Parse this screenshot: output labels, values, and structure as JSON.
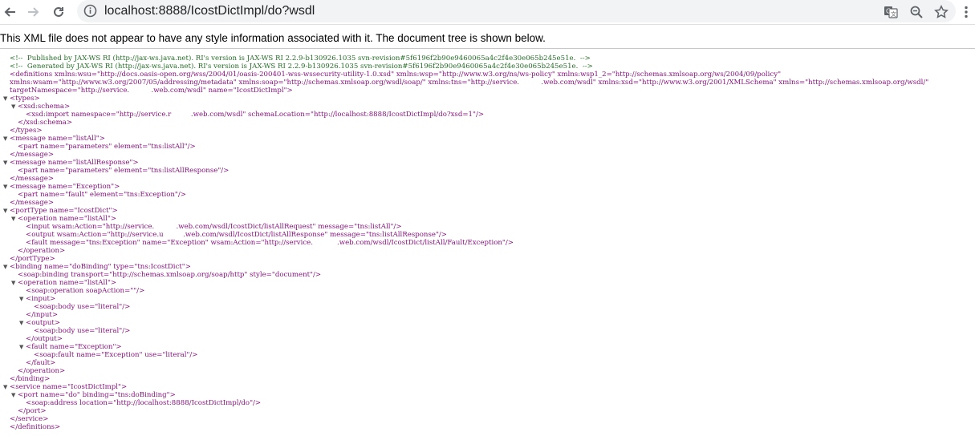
{
  "browser": {
    "url": "localhost:8888/IcostDictImpl/do?wsdl",
    "icons": [
      "back-arrow-icon",
      "forward-arrow-icon",
      "reload-icon",
      "info-icon",
      "translate-icon",
      "zoom-icon",
      "star-icon",
      "menu-dots-icon"
    ]
  },
  "banner": {
    "text": "This XML file does not appear to have any style information associated with it. The document tree is shown below."
  },
  "xml": {
    "lines": [
      {
        "indent": 0,
        "toggle": "",
        "text": "<!--  Published by JAX-WS RI (http://jax-ws.java.net). RI's version is JAX-WS RI 2.2.9-b130926.1035 svn-revision#5f6196f2b90e9460065a4c2f4e30e065b245e51e.  -->",
        "kind": "comment"
      },
      {
        "indent": 0,
        "toggle": "",
        "text": "<!--  Generated by JAX-WS RI (http://jax-ws.java.net). RI's version is JAX-WS RI 2.2.9-b130926.1035 svn-revision#5f6196f2b90e9460065a4c2f4e30e065b245e51e.  -->",
        "kind": "comment"
      },
      {
        "indent": 0,
        "toggle": "",
        "text": "<definitions xmlns:wsu=\"http://docs.oasis-open.org/wss/2004/01/oasis-200401-wss-wssecurity-utility-1.0.xsd\" xmlns:wsp=\"http://www.w3.org/ns/ws-policy\" xmlns:wsp1_2=\"http://schemas.xmlsoap.org/ws/2004/09/policy\"",
        "kind": "tag"
      },
      {
        "indent": 0,
        "toggle": "",
        "text": "xmlns:wsam=\"http://www.w3.org/2007/05/addressing/metadata\" xmlns:soap=\"http://schemas.xmlsoap.org/wsdl/soap/\" xmlns:tns=\"http://service.          .web.com/wsdl\" xmlns:xsd=\"http://www.w3.org/2001/XMLSchema\" xmlns=\"http://schemas.xmlsoap.org/wsdl/\"",
        "kind": "tag"
      },
      {
        "indent": 0,
        "toggle": "",
        "text": "targetNamespace=\"http://service.          .web.com/wsdl\" name=\"IcostDictImpl\">",
        "kind": "tag"
      },
      {
        "indent": 0,
        "toggle": "▼",
        "text": "<types>",
        "kind": "tag"
      },
      {
        "indent": 1,
        "toggle": "▼",
        "text": "<xsd:schema>",
        "kind": "tag"
      },
      {
        "indent": 2,
        "toggle": "",
        "text": "<xsd:import namespace=\"http://service.r         .web.com/wsdl\" schemaLocation=\"http://localhost:8888/IcostDictImpl/do?xsd=1\"/>",
        "kind": "tag"
      },
      {
        "indent": 1,
        "toggle": "",
        "text": "</xsd:schema>",
        "kind": "tag"
      },
      {
        "indent": 0,
        "toggle": "",
        "text": "</types>",
        "kind": "tag"
      },
      {
        "indent": 0,
        "toggle": "▼",
        "text": "<message name=\"listAll\">",
        "kind": "tag"
      },
      {
        "indent": 1,
        "toggle": "",
        "text": "<part name=\"parameters\" element=\"tns:listAll\"/>",
        "kind": "tag"
      },
      {
        "indent": 0,
        "toggle": "",
        "text": "</message>",
        "kind": "tag"
      },
      {
        "indent": 0,
        "toggle": "▼",
        "text": "<message name=\"listAllResponse\">",
        "kind": "tag"
      },
      {
        "indent": 1,
        "toggle": "",
        "text": "<part name=\"parameters\" element=\"tns:listAllResponse\"/>",
        "kind": "tag"
      },
      {
        "indent": 0,
        "toggle": "",
        "text": "</message>",
        "kind": "tag"
      },
      {
        "indent": 0,
        "toggle": "▼",
        "text": "<message name=\"Exception\">",
        "kind": "tag"
      },
      {
        "indent": 1,
        "toggle": "",
        "text": "<part name=\"fault\" element=\"tns:Exception\"/>",
        "kind": "tag"
      },
      {
        "indent": 0,
        "toggle": "",
        "text": "</message>",
        "kind": "tag"
      },
      {
        "indent": 0,
        "toggle": "▼",
        "text": "<portType name=\"IcostDict\">",
        "kind": "tag"
      },
      {
        "indent": 1,
        "toggle": "▼",
        "text": "<operation name=\"listAll\">",
        "kind": "tag"
      },
      {
        "indent": 2,
        "toggle": "",
        "text": "<input wsam:Action=\"http://service.          .web.com/wsdl/IcostDict/listAllRequest\" message=\"tns:listAll\"/>",
        "kind": "tag"
      },
      {
        "indent": 2,
        "toggle": "",
        "text": "<output wsam:Action=\"http://service.u         .web.com/wsdl/IcostDict/listAllResponse\" message=\"tns:listAllResponse\"/>",
        "kind": "tag"
      },
      {
        "indent": 2,
        "toggle": "",
        "text": "<fault message=\"tns:Exception\" name=\"Exception\" wsam:Action=\"http://service.           .web.com/wsdl/IcostDict/listAll/Fault/Exception\"/>",
        "kind": "tag"
      },
      {
        "indent": 1,
        "toggle": "",
        "text": "</operation>",
        "kind": "tag"
      },
      {
        "indent": 0,
        "toggle": "",
        "text": "</portType>",
        "kind": "tag"
      },
      {
        "indent": 0,
        "toggle": "▼",
        "text": "<binding name=\"doBinding\" type=\"tns:IcostDict\">",
        "kind": "tag"
      },
      {
        "indent": 1,
        "toggle": "",
        "text": "<soap:binding transport=\"http://schemas.xmlsoap.org/soap/http\" style=\"document\"/>",
        "kind": "tag"
      },
      {
        "indent": 1,
        "toggle": "▼",
        "text": "<operation name=\"listAll\">",
        "kind": "tag"
      },
      {
        "indent": 2,
        "toggle": "",
        "text": "<soap:operation soapAction=\"\"/>",
        "kind": "tag"
      },
      {
        "indent": 2,
        "toggle": "▼",
        "text": "<input>",
        "kind": "tag"
      },
      {
        "indent": 3,
        "toggle": "",
        "text": "<soap:body use=\"literal\"/>",
        "kind": "tag"
      },
      {
        "indent": 2,
        "toggle": "",
        "text": "</input>",
        "kind": "tag"
      },
      {
        "indent": 2,
        "toggle": "▼",
        "text": "<output>",
        "kind": "tag"
      },
      {
        "indent": 3,
        "toggle": "",
        "text": "<soap:body use=\"literal\"/>",
        "kind": "tag"
      },
      {
        "indent": 2,
        "toggle": "",
        "text": "</output>",
        "kind": "tag"
      },
      {
        "indent": 2,
        "toggle": "▼",
        "text": "<fault name=\"Exception\">",
        "kind": "tag"
      },
      {
        "indent": 3,
        "toggle": "",
        "text": "<soap:fault name=\"Exception\" use=\"literal\"/>",
        "kind": "tag"
      },
      {
        "indent": 2,
        "toggle": "",
        "text": "</fault>",
        "kind": "tag"
      },
      {
        "indent": 1,
        "toggle": "",
        "text": "</operation>",
        "kind": "tag"
      },
      {
        "indent": 0,
        "toggle": "",
        "text": "</binding>",
        "kind": "tag"
      },
      {
        "indent": 0,
        "toggle": "▼",
        "text": "<service name=\"IcostDictImpl\">",
        "kind": "tag"
      },
      {
        "indent": 1,
        "toggle": "▼",
        "text": "<port name=\"do\" binding=\"tns:doBinding\">",
        "kind": "tag"
      },
      {
        "indent": 2,
        "toggle": "",
        "text": "<soap:address location=\"http://localhost:8888/IcostDictImpl/do\"/>",
        "kind": "tag"
      },
      {
        "indent": 1,
        "toggle": "",
        "text": "</port>",
        "kind": "tag"
      },
      {
        "indent": 0,
        "toggle": "",
        "text": "</service>",
        "kind": "tag"
      },
      {
        "indent": 0,
        "toggle": "",
        "text": "</definitions>",
        "kind": "tag"
      }
    ]
  }
}
